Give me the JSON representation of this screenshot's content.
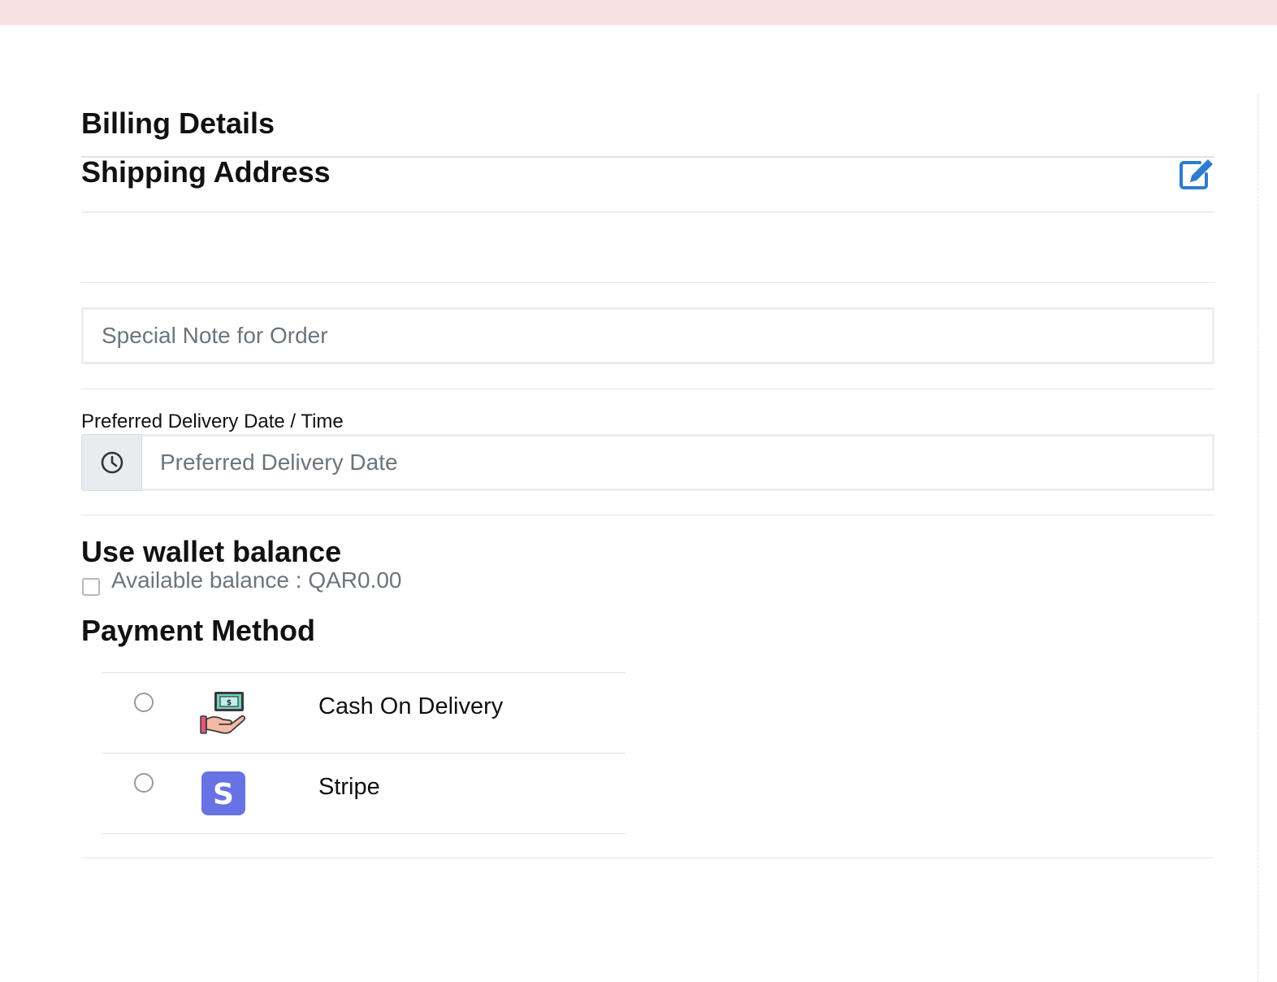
{
  "billing": {
    "title": "Billing Details"
  },
  "shipping": {
    "title": "Shipping Address",
    "edit_icon": "edit-icon",
    "accent_color": "#2e7bcf"
  },
  "order_note": {
    "placeholder": "Special Note for Order"
  },
  "delivery": {
    "label": "Preferred Delivery Date / Time",
    "placeholder": "Preferred Delivery Date",
    "icon": "clock-icon"
  },
  "wallet": {
    "title": "Use wallet balance",
    "balance_text": "Available balance : QAR0.00",
    "checked": false
  },
  "payment": {
    "title": "Payment Method",
    "methods": [
      {
        "label": "Cash On Delivery",
        "icon": "cash-on-delivery-icon",
        "selected": false
      },
      {
        "label": "Stripe",
        "icon": "stripe-icon",
        "icon_letter": "S",
        "icon_color": "#6772e5",
        "selected": false
      }
    ]
  },
  "colors": {
    "banner": "#f9e1e1",
    "input_border": "#ededed",
    "placeholder": "#6c757d",
    "addon_bg": "#e9ecef"
  }
}
